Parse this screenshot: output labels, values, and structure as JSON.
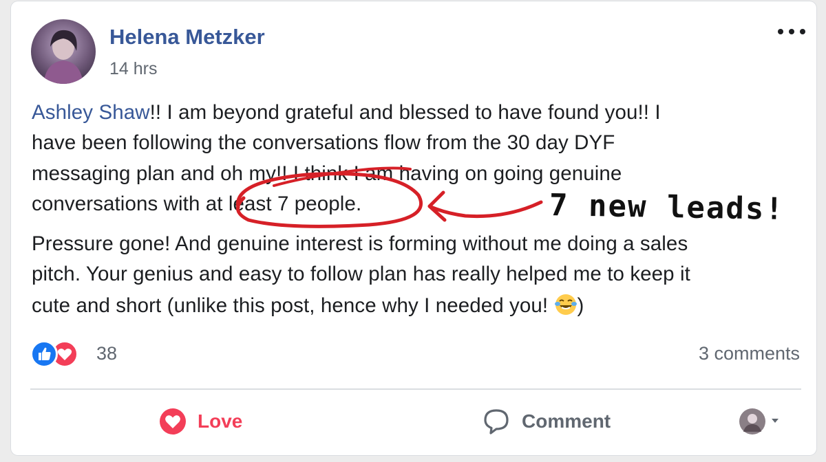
{
  "post": {
    "author": "Helena Metzker",
    "time": "14 hrs",
    "mention": "Ashley Shaw",
    "lines": [
      "!! I am beyond grateful and blessed to have found you!! I",
      "have been following the conversations flow from the 30 day DYF",
      "messaging plan and oh my!! I think I am having on going genuine",
      "conversations with at least 7 people.",
      "Pressure gone! And genuine interest is forming without me doing a sales",
      "pitch. Your genius and easy to follow plan has really helped me to keep it",
      "cute and short (unlike this post, hence why I needed you! ",
      ")"
    ],
    "inline_emoji": "face-with-tears-of-joy-icon"
  },
  "annotation": {
    "text": "7 new leads!",
    "circle_color": "#d62027"
  },
  "stats": {
    "reaction_count": "38",
    "comments": "3 comments"
  },
  "actions": {
    "love_label": "Love",
    "comment_label": "Comment"
  },
  "colors": {
    "link": "#385898",
    "love": "#f33e58",
    "like": "#1877f2",
    "text": "#1c1e21",
    "secondary": "#606770"
  }
}
